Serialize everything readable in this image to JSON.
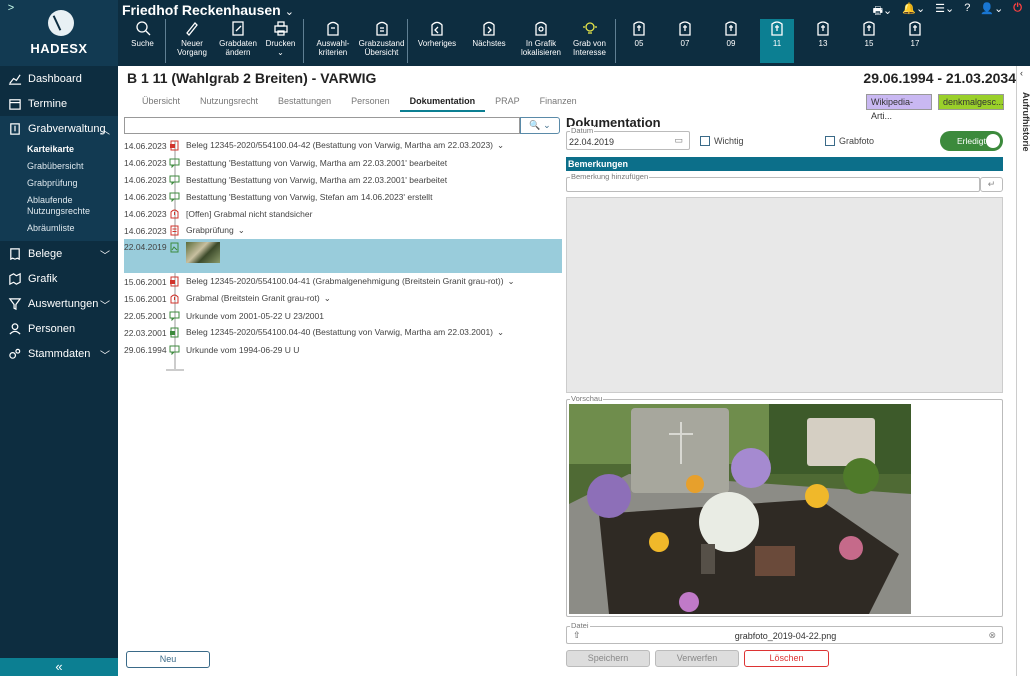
{
  "app": {
    "brand": "HADESX",
    "expand_glyph": ">",
    "cemetery": "Friedhof Reckenhausen",
    "cemetery_chevron": "⌄"
  },
  "toolbar": [
    {
      "label": "Suche",
      "icon": "search-icon"
    },
    {
      "label": "Neuer Vorgang",
      "icon": "pen-icon"
    },
    {
      "label": "Grabdaten ändern",
      "icon": "edit-doc-icon"
    },
    {
      "label": "Drucken ⌄",
      "icon": "printer-icon"
    },
    {
      "label": "Auswahl-kriterien",
      "icon": "grave-icon"
    },
    {
      "label": "Grabzustand Übersicht",
      "icon": "grave-list-icon"
    },
    {
      "label": "Vorheriges",
      "icon": "prev-grave-icon"
    },
    {
      "label": "Nächstes",
      "icon": "next-grave-icon"
    },
    {
      "label": "In Grafik lokalisieren",
      "icon": "locate-icon"
    },
    {
      "label": "Grab von Interesse",
      "icon": "bulb-icon"
    }
  ],
  "graves": [
    "05",
    "07",
    "09",
    "11",
    "13",
    "15",
    "17"
  ],
  "active_grave": "11",
  "top_right": {
    "printer": "🖶⌄",
    "bell": "🔔⌄",
    "filters": "☰⌄",
    "help": "?",
    "user": "👤⌄",
    "power": "⏻"
  },
  "sidebar": {
    "items": [
      {
        "label": "Dashboard",
        "icon": "chart-icon"
      },
      {
        "label": "Termine",
        "icon": "calendar-icon"
      },
      {
        "label": "Grabverwaltung",
        "icon": "grave-admin-icon",
        "open": true
      },
      {
        "label": "Belege",
        "icon": "receipt-icon"
      },
      {
        "label": "Grafik",
        "icon": "map-icon"
      },
      {
        "label": "Auswertungen",
        "icon": "filter-icon"
      },
      {
        "label": "Personen",
        "icon": "person-icon"
      },
      {
        "label": "Stammdaten",
        "icon": "gears-icon"
      }
    ],
    "sub_items": [
      "Karteikarte",
      "Grabübersicht",
      "Grabprüfung",
      "Ablaufende Nutzungsrechte",
      "Abräumliste"
    ],
    "active_sub": "Karteikarte",
    "collapse": "«"
  },
  "right_strip": {
    "label": "Aufrufhistorie",
    "chevron": "‹"
  },
  "page": {
    "title": "B 1 11 (Wahlgrab 2 Breiten) - VARWIG",
    "dates": "29.06.1994 - 21.03.2034"
  },
  "tabs": [
    "Übersicht",
    "Nutzungsrecht",
    "Bestattungen",
    "Personen",
    "Dokumentation",
    "PRAP",
    "Finanzen"
  ],
  "active_tab": "Dokumentation",
  "tags": {
    "wiki": "Wikipedia-Arti...",
    "denk": "denkmalgesc..."
  },
  "timeline_search": {
    "button": "🔍 ⌄"
  },
  "timeline": [
    {
      "date": "14.06.2023",
      "text": "Beleg 12345-2020/554100.04-42 (Bestattung von Varwig, Martha am 22.03.2023)",
      "icon": "pdf-icon",
      "color": "#d0342c",
      "chevron": "⌄"
    },
    {
      "date": "14.06.2023",
      "text": "Bestattung 'Bestattung von Varwig, Martha am 22.03.2001' bearbeitet",
      "icon": "comment-icon",
      "color": "#3c8a3c",
      "chevron": ""
    },
    {
      "date": "14.06.2023",
      "text": "Bestattung 'Bestattung von Varwig, Martha am 22.03.2001' bearbeitet",
      "icon": "comment-icon",
      "color": "#3c8a3c",
      "chevron": ""
    },
    {
      "date": "14.06.2023",
      "text": "Bestattung 'Bestattung von Varwig, Stefan am 14.06.2023' erstellt",
      "icon": "comment-icon",
      "color": "#3c8a3c",
      "chevron": ""
    },
    {
      "date": "14.06.2023",
      "text": "[Offen] Grabmal nicht standsicher",
      "icon": "grave-warning-icon",
      "color": "#d0342c",
      "chevron": ""
    },
    {
      "date": "14.06.2023",
      "text": "Grabprüfung",
      "icon": "checklist-icon",
      "color": "#d0342c",
      "chevron": "⌄"
    },
    {
      "date": "22.04.2019",
      "text": "",
      "icon": "image-doc-icon",
      "color": "#3c8a3c",
      "chevron": "",
      "selected": true
    },
    {
      "date": "15.06.2001",
      "text": "Beleg 12345-2020/554100.04-41 (Grabmalgenehmigung (Breitstein Granit grau-rot))",
      "icon": "pdf-icon",
      "color": "#d0342c",
      "chevron": "⌄"
    },
    {
      "date": "15.06.2001",
      "text": "Grabmal (Breitstein Granit grau-rot)",
      "icon": "grave-warning-icon",
      "color": "#d0342c",
      "chevron": "⌄"
    },
    {
      "date": "22.05.2001",
      "text": "Urkunde vom 2001-05-22 U 23/2001",
      "icon": "comment-icon",
      "color": "#3c8a3c",
      "chevron": ""
    },
    {
      "date": "22.03.2001",
      "text": "Beleg 12345-2020/554100.04-40 (Bestattung von Varwig, Martha am 22.03.2001)",
      "icon": "excel-icon",
      "color": "#3c8a3c",
      "chevron": "⌄"
    },
    {
      "date": "29.06.1994",
      "text": "Urkunde vom 1994-06-29 U U",
      "icon": "comment-icon",
      "color": "#3c8a3c",
      "chevron": ""
    }
  ],
  "new_button": "Neu",
  "doc": {
    "title": "Dokumentation",
    "date_label": "Datum",
    "date_value": "22.04.2019",
    "cal_glyph": "▭",
    "wichtig": "Wichtig",
    "grabfoto": "Grabfoto",
    "erledigt": "Erledigt",
    "erledigt_on": true,
    "bemerkungen": "Bemerkungen",
    "bem_placeholder": "Bemerkung hinzufügen",
    "bem_add_glyph": "↵",
    "vorschau": "Vorschau",
    "datei_label": "Datei",
    "file_name": "grabfoto_2019-04-22.png",
    "upload_glyph": "⇧",
    "clear_glyph": "⊗",
    "save": "Speichern",
    "discard": "Verwerfen",
    "delete": "Löschen"
  },
  "colors": {
    "navy": "#0d2d40",
    "teal": "#0c7f92",
    "green": "#3c8a3c",
    "red": "#d0342c"
  }
}
